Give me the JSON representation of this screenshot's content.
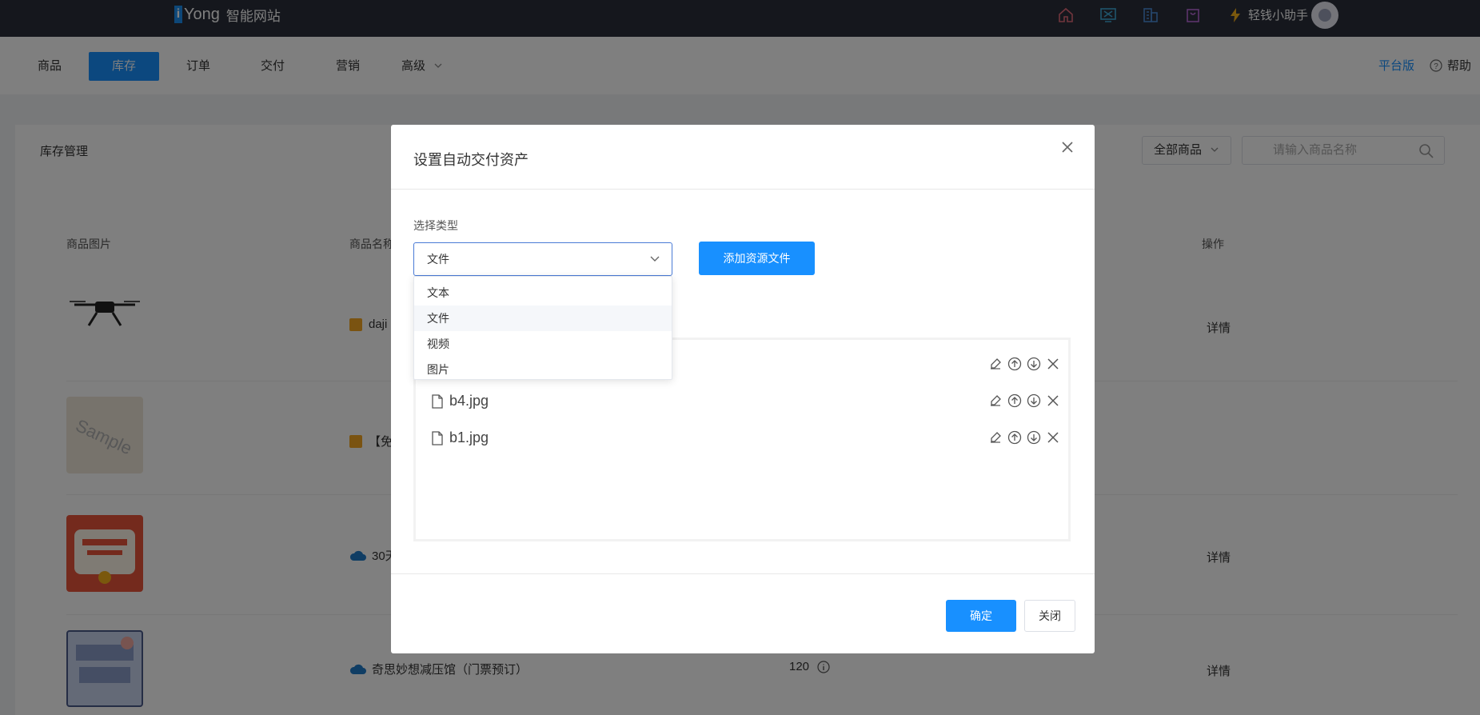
{
  "topbar": {
    "logo_mark": "i",
    "logo_name": "Yong",
    "logo_sub": "智能网站",
    "user_name": "轻钱小助手"
  },
  "nav": {
    "items": [
      "商品",
      "库存",
      "订单",
      "交付",
      "营销",
      "高级"
    ],
    "active_index": 1,
    "platform": "平台版",
    "help": "帮助"
  },
  "panel": {
    "title": "库存管理",
    "filter": "全部商品",
    "search_placeholder": "请输入商品名称",
    "headers": {
      "image": "商品图片",
      "name": "商品名称",
      "actions": "操作"
    },
    "rows": [
      {
        "name": "daji",
        "tag": "square",
        "action": "详情"
      },
      {
        "name": "【免",
        "tag": "square",
        "action": ""
      },
      {
        "name": "30天",
        "tag": "cloud",
        "action": "详情"
      },
      {
        "name": "奇思妙想减压馆（门票预订）",
        "tag": "cloud",
        "stock": "120",
        "action": "详情"
      }
    ]
  },
  "modal": {
    "title": "设置自动交付资产",
    "type_label": "选择类型",
    "selected_type": "文件",
    "add_button": "添加资源文件",
    "options": [
      "文本",
      "文件",
      "视频",
      "图片"
    ],
    "hovered_option": 1,
    "files": [
      "b4.jpg",
      "b1.jpg"
    ],
    "ok": "确定",
    "close": "关闭"
  },
  "colors": {
    "accent": "#1890ff",
    "topbar": "#2b2f3a"
  }
}
